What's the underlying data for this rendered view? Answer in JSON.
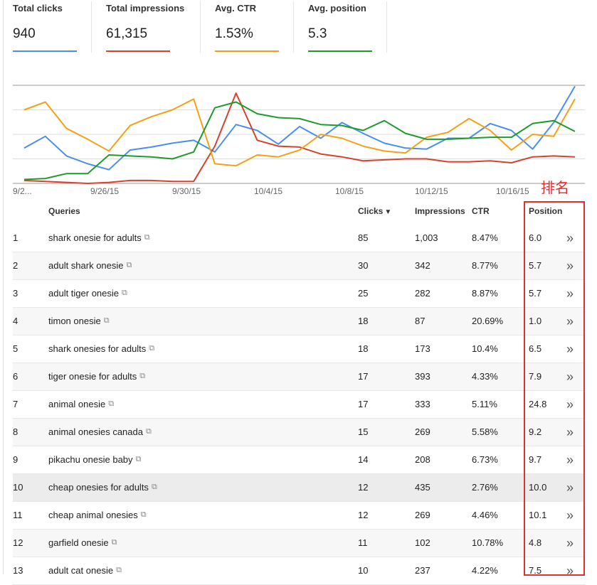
{
  "metrics": [
    {
      "label": "Total clicks",
      "value": "940",
      "color": "#4a8ff0"
    },
    {
      "label": "Total impressions",
      "value": "61,315",
      "color": "#d7422e"
    },
    {
      "label": "Avg. CTR",
      "value": "1.53%",
      "color": "#f4a11a"
    },
    {
      "label": "Avg. position",
      "value": "5.3",
      "color": "#1f9a2f"
    }
  ],
  "chart_data": {
    "type": "line",
    "x": [
      "9/22",
      "9/23",
      "9/24",
      "9/25",
      "9/26",
      "9/27",
      "9/28",
      "9/29",
      "9/30",
      "10/1",
      "10/2",
      "10/3",
      "10/4",
      "10/5",
      "10/6",
      "10/7",
      "10/8",
      "10/9",
      "10/10",
      "10/11",
      "10/12",
      "10/13",
      "10/14",
      "10/15",
      "10/16",
      "10/17",
      "10/18"
    ],
    "tick_labels": [
      "9/2...",
      "9/26/15",
      "9/30/15",
      "10/4/15",
      "10/8/15",
      "10/12/15",
      "10/16/15"
    ],
    "gridlines": 4,
    "series": [
      {
        "name": "Total clicks",
        "color": "#4a8ff0",
        "values": [
          36,
          48,
          28,
          20,
          14,
          34,
          37,
          41,
          44,
          32,
          60,
          54,
          40,
          58,
          46,
          62,
          51,
          41,
          36,
          35,
          46,
          46,
          61,
          54,
          35,
          62,
          99
        ]
      },
      {
        "name": "Total impressions",
        "color": "#d7422e",
        "values": [
          3,
          2,
          1,
          0,
          1,
          3,
          3,
          2,
          2,
          38,
          92,
          44,
          38,
          37,
          30,
          27,
          23,
          24,
          25,
          25,
          22,
          22,
          23,
          21,
          27,
          28,
          27
        ]
      },
      {
        "name": "Avg. CTR",
        "color": "#f4a11a",
        "values": [
          75,
          83,
          56,
          45,
          33,
          59,
          68,
          75,
          86,
          20,
          18,
          29,
          27,
          34,
          50,
          46,
          38,
          33,
          31,
          47,
          52,
          66,
          54,
          34,
          50,
          48,
          86
        ]
      },
      {
        "name": "Avg. position",
        "color": "#1f9a2f",
        "values": [
          4,
          5,
          10,
          10,
          29,
          28,
          27,
          25,
          32,
          77,
          83,
          71,
          67,
          66,
          60,
          59,
          54,
          64,
          51,
          45,
          45,
          46,
          47,
          47,
          61,
          64,
          53
        ]
      }
    ]
  },
  "table": {
    "headers": {
      "queries": "Queries",
      "clicks": "Clicks",
      "impressions": "Impressions",
      "ctr": "CTR",
      "position": "Position"
    },
    "sort_indicator": "▼",
    "rows": [
      {
        "n": "1",
        "query": "shark onesie for adults",
        "clicks": "85",
        "impressions": "1,003",
        "ctr": "8.47%",
        "position": "6.0"
      },
      {
        "n": "2",
        "query": "adult shark onesie",
        "clicks": "30",
        "impressions": "342",
        "ctr": "8.77%",
        "position": "5.7"
      },
      {
        "n": "3",
        "query": "adult tiger onesie",
        "clicks": "25",
        "impressions": "282",
        "ctr": "8.87%",
        "position": "5.7"
      },
      {
        "n": "4",
        "query": "timon onesie",
        "clicks": "18",
        "impressions": "87",
        "ctr": "20.69%",
        "position": "1.0"
      },
      {
        "n": "5",
        "query": "shark onesies for adults",
        "clicks": "18",
        "impressions": "173",
        "ctr": "10.4%",
        "position": "6.5"
      },
      {
        "n": "6",
        "query": "tiger onesie for adults",
        "clicks": "17",
        "impressions": "393",
        "ctr": "4.33%",
        "position": "7.9"
      },
      {
        "n": "7",
        "query": "animal onesie",
        "clicks": "17",
        "impressions": "333",
        "ctr": "5.11%",
        "position": "24.8"
      },
      {
        "n": "8",
        "query": "animal onesies canada",
        "clicks": "15",
        "impressions": "269",
        "ctr": "5.58%",
        "position": "9.2"
      },
      {
        "n": "9",
        "query": "pikachu onesie baby",
        "clicks": "14",
        "impressions": "208",
        "ctr": "6.73%",
        "position": "9.7"
      },
      {
        "n": "10",
        "query": "cheap onesies for adults",
        "clicks": "12",
        "impressions": "435",
        "ctr": "2.76%",
        "position": "10.0"
      },
      {
        "n": "11",
        "query": "cheap animal onesies",
        "clicks": "12",
        "impressions": "269",
        "ctr": "4.46%",
        "position": "10.1"
      },
      {
        "n": "12",
        "query": "garfield onesie",
        "clicks": "11",
        "impressions": "102",
        "ctr": "10.78%",
        "position": "4.8"
      },
      {
        "n": "13",
        "query": "adult cat onesie",
        "clicks": "10",
        "impressions": "237",
        "ctr": "4.22%",
        "position": "7.5"
      }
    ],
    "highlighted_row": "10",
    "external_link_icon": "external-link-icon",
    "row_action_icon": "double-chevron-right-icon",
    "row_action_glyph": "»"
  },
  "annotation": {
    "text": "排名",
    "color": "#e03030"
  }
}
